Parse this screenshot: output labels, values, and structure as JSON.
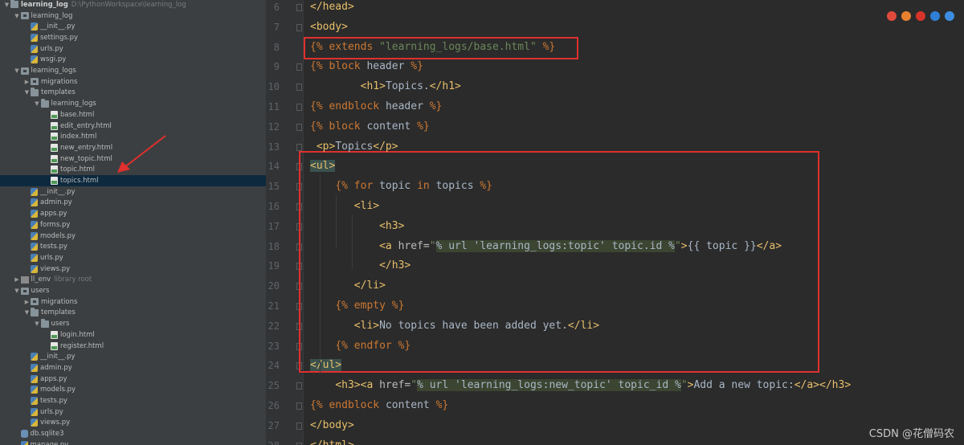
{
  "project_tree": [
    {
      "label": "learning_log",
      "note": "D:\\PythonWorkspace\\learning_log",
      "icon": "folder",
      "expanded": true,
      "depth": 0,
      "bold": true
    },
    {
      "label": "learning_log",
      "icon": "pkg",
      "expanded": true,
      "depth": 1
    },
    {
      "label": "__init__.py",
      "icon": "py",
      "depth": 2
    },
    {
      "label": "settings.py",
      "icon": "py",
      "depth": 2
    },
    {
      "label": "urls.py",
      "icon": "py",
      "depth": 2
    },
    {
      "label": "wsgi.py",
      "icon": "py",
      "depth": 2
    },
    {
      "label": "learning_logs",
      "icon": "pkg",
      "expanded": true,
      "depth": 1
    },
    {
      "label": "migrations",
      "icon": "pkg",
      "expanded": false,
      "depth": 2
    },
    {
      "label": "templates",
      "icon": "folder",
      "expanded": true,
      "depth": 2
    },
    {
      "label": "learning_logs",
      "icon": "folder",
      "expanded": true,
      "depth": 3
    },
    {
      "label": "base.html",
      "icon": "html",
      "depth": 4
    },
    {
      "label": "edit_entry.html",
      "icon": "html",
      "depth": 4
    },
    {
      "label": "index.html",
      "icon": "html",
      "depth": 4
    },
    {
      "label": "new_entry.html",
      "icon": "html",
      "depth": 4
    },
    {
      "label": "new_topic.html",
      "icon": "html",
      "depth": 4
    },
    {
      "label": "topic.html",
      "icon": "html",
      "depth": 4
    },
    {
      "label": "topics.html",
      "icon": "html",
      "depth": 4,
      "selected": true
    },
    {
      "label": "__init__.py",
      "icon": "py",
      "depth": 2
    },
    {
      "label": "admin.py",
      "icon": "py",
      "depth": 2
    },
    {
      "label": "apps.py",
      "icon": "py",
      "depth": 2
    },
    {
      "label": "forms.py",
      "icon": "py",
      "depth": 2
    },
    {
      "label": "models.py",
      "icon": "py",
      "depth": 2
    },
    {
      "label": "tests.py",
      "icon": "py",
      "depth": 2
    },
    {
      "label": "urls.py",
      "icon": "py",
      "depth": 2
    },
    {
      "label": "views.py",
      "icon": "py",
      "depth": 2
    },
    {
      "label": "ll_env",
      "note": "library root",
      "icon": "lib",
      "expanded": false,
      "depth": 1
    },
    {
      "label": "users",
      "icon": "pkg",
      "expanded": true,
      "depth": 1
    },
    {
      "label": "migrations",
      "icon": "pkg",
      "expanded": false,
      "depth": 2
    },
    {
      "label": "templates",
      "icon": "folder",
      "expanded": true,
      "depth": 2
    },
    {
      "label": "users",
      "icon": "folder",
      "expanded": true,
      "depth": 3
    },
    {
      "label": "login.html",
      "icon": "html",
      "depth": 4
    },
    {
      "label": "register.html",
      "icon": "html",
      "depth": 4
    },
    {
      "label": "__init__.py",
      "icon": "py",
      "depth": 2
    },
    {
      "label": "admin.py",
      "icon": "py",
      "depth": 2
    },
    {
      "label": "apps.py",
      "icon": "py",
      "depth": 2
    },
    {
      "label": "models.py",
      "icon": "py",
      "depth": 2
    },
    {
      "label": "tests.py",
      "icon": "py",
      "depth": 2
    },
    {
      "label": "urls.py",
      "icon": "py",
      "depth": 2
    },
    {
      "label": "views.py",
      "icon": "py",
      "depth": 2
    },
    {
      "label": "db.sqlite3",
      "icon": "db",
      "depth": 1
    },
    {
      "label": "manage.py",
      "icon": "py",
      "depth": 1
    }
  ],
  "code_lines": [
    {
      "num": "6",
      "tokens": [
        [
          "tag",
          "</head>"
        ]
      ]
    },
    {
      "num": "7",
      "tokens": [
        [
          "tag",
          "<body>"
        ]
      ]
    },
    {
      "num": "8",
      "tokens": [
        [
          "tpl",
          "{% "
        ],
        [
          "tpl",
          "extends "
        ],
        [
          "str",
          "\"learning_logs/base.html\""
        ],
        [
          "tpl",
          " %}"
        ]
      ]
    },
    {
      "num": "9",
      "tokens": [
        [
          "tpl",
          "{% "
        ],
        [
          "tpl",
          "block "
        ],
        [
          "tplv",
          "header "
        ],
        [
          "tpl",
          "%}"
        ]
      ]
    },
    {
      "num": "10",
      "tokens": [
        [
          "txt",
          "        "
        ],
        [
          "tag",
          "<h1>"
        ],
        [
          "txt",
          "Topics."
        ],
        [
          "tag",
          "</h1>"
        ]
      ]
    },
    {
      "num": "11",
      "tokens": [
        [
          "tpl",
          "{% "
        ],
        [
          "tpl",
          "endblock "
        ],
        [
          "tplv",
          "header "
        ],
        [
          "tpl",
          "%}"
        ]
      ]
    },
    {
      "num": "12",
      "tokens": [
        [
          "tpl",
          "{% "
        ],
        [
          "tpl",
          "block "
        ],
        [
          "tplv",
          "content "
        ],
        [
          "tpl",
          "%}"
        ]
      ]
    },
    {
      "num": "13",
      "tokens": [
        [
          "txt",
          " "
        ],
        [
          "tag",
          "<p>"
        ],
        [
          "txt",
          "Topics"
        ],
        [
          "tag",
          "</p>"
        ]
      ]
    },
    {
      "num": "14",
      "tokens": [
        [
          "tagbg",
          "<ul>"
        ]
      ]
    },
    {
      "num": "15",
      "tokens": [
        [
          "txt",
          "    "
        ],
        [
          "tpl",
          "{% "
        ],
        [
          "tpl",
          "for "
        ],
        [
          "tplv",
          "topic "
        ],
        [
          "tpl",
          "in "
        ],
        [
          "tplv",
          "topics "
        ],
        [
          "tpl",
          "%}"
        ]
      ]
    },
    {
      "num": "16",
      "tokens": [
        [
          "txt",
          "       "
        ],
        [
          "tag",
          "<li>"
        ]
      ]
    },
    {
      "num": "17",
      "tokens": [
        [
          "txt",
          "           "
        ],
        [
          "tag",
          "<h3>"
        ]
      ]
    },
    {
      "num": "18",
      "tokens": [
        [
          "txt",
          "           "
        ],
        [
          "tag",
          "<a "
        ],
        [
          "attr",
          "href="
        ],
        [
          "str",
          "\""
        ],
        [
          "strbg",
          "% url 'learning_logs:topic' topic.id %"
        ],
        [
          "str",
          "\""
        ],
        [
          "tag",
          ">"
        ],
        [
          "txt",
          "{{ topic }}"
        ],
        [
          "tag",
          "</a>"
        ]
      ]
    },
    {
      "num": "19",
      "tokens": [
        [
          "txt",
          "           "
        ],
        [
          "tag",
          "</h3>"
        ]
      ]
    },
    {
      "num": "20",
      "tokens": [
        [
          "txt",
          "       "
        ],
        [
          "tag",
          "</li>"
        ]
      ]
    },
    {
      "num": "21",
      "tokens": [
        [
          "txt",
          "    "
        ],
        [
          "tpl",
          "{% "
        ],
        [
          "tpl",
          "empty "
        ],
        [
          "tpl",
          "%}"
        ]
      ]
    },
    {
      "num": "22",
      "tokens": [
        [
          "txt",
          "       "
        ],
        [
          "tag",
          "<li>"
        ],
        [
          "txt",
          "No topics have been added yet."
        ],
        [
          "tag",
          "</li>"
        ]
      ]
    },
    {
      "num": "23",
      "tokens": [
        [
          "txt",
          "    "
        ],
        [
          "tpl",
          "{% "
        ],
        [
          "tpl",
          "endfor "
        ],
        [
          "tpl",
          "%}"
        ]
      ]
    },
    {
      "num": "24",
      "tokens": [
        [
          "tagbg",
          "</ul>"
        ]
      ]
    },
    {
      "num": "25",
      "tokens": [
        [
          "txt",
          "    "
        ],
        [
          "tag",
          "<h3>"
        ],
        [
          "tag",
          "<a "
        ],
        [
          "attr",
          "href="
        ],
        [
          "str",
          "\""
        ],
        [
          "strbg",
          "% url 'learning_logs:new_topic' topic_id %"
        ],
        [
          "str",
          "\""
        ],
        [
          "tag",
          ">"
        ],
        [
          "txt",
          "Add a new topic:"
        ],
        [
          "tag",
          "</a></h3>"
        ]
      ]
    },
    {
      "num": "26",
      "tokens": [
        [
          "tpl",
          "{% "
        ],
        [
          "tpl",
          "endblock "
        ],
        [
          "tplv",
          "content "
        ],
        [
          "tpl",
          "%}"
        ]
      ]
    },
    {
      "num": "27",
      "tokens": [
        [
          "tag",
          "</body>"
        ]
      ]
    },
    {
      "num": "28",
      "tokens": [
        [
          "tag",
          "</html>"
        ]
      ]
    }
  ],
  "watermark": "CSDN @花僧码农",
  "colors": {
    "annotation_red": "#e0302e",
    "selection": "#0d293e",
    "editor_bg": "#2b2b2b",
    "sidebar_bg": "#3c3f41"
  },
  "browser_icons": [
    "chrome-icon",
    "firefox-icon",
    "opera-icon",
    "edge-icon",
    "ie-icon"
  ]
}
